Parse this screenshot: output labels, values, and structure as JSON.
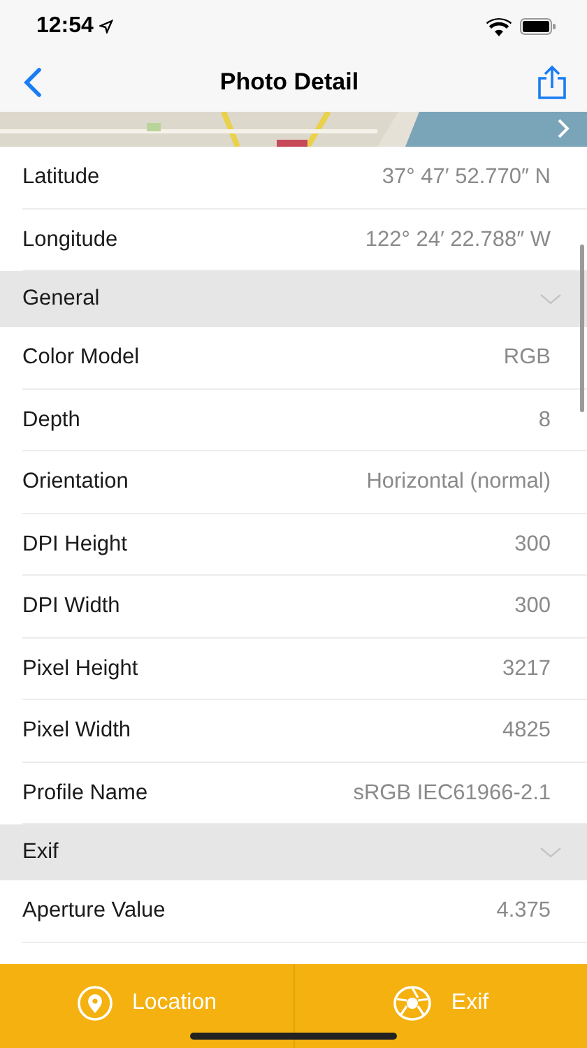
{
  "status_bar": {
    "time": "12:54"
  },
  "nav": {
    "title": "Photo Detail"
  },
  "location_rows": [
    {
      "label": "Latitude",
      "value": "37° 47′ 52.770″ N"
    },
    {
      "label": "Longitude",
      "value": "122° 24′ 22.788″ W"
    }
  ],
  "sections": [
    {
      "title": "General",
      "expanded": true,
      "rows": [
        {
          "label": "Color Model",
          "value": "RGB"
        },
        {
          "label": "Depth",
          "value": "8"
        },
        {
          "label": "Orientation",
          "value": "Horizontal (normal)"
        },
        {
          "label": "DPI Height",
          "value": "300"
        },
        {
          "label": "DPI Width",
          "value": "300"
        },
        {
          "label": "Pixel Height",
          "value": "3217"
        },
        {
          "label": "Pixel Width",
          "value": "4825"
        },
        {
          "label": "Profile Name",
          "value": "sRGB IEC61966-2.1"
        }
      ]
    },
    {
      "title": "Exif",
      "expanded": true,
      "rows": [
        {
          "label": "Aperture Value",
          "value": "4.375"
        }
      ]
    }
  ],
  "tab_bar": [
    {
      "kind": "location",
      "label": "Location"
    },
    {
      "kind": "exif",
      "label": "Exif"
    }
  ]
}
